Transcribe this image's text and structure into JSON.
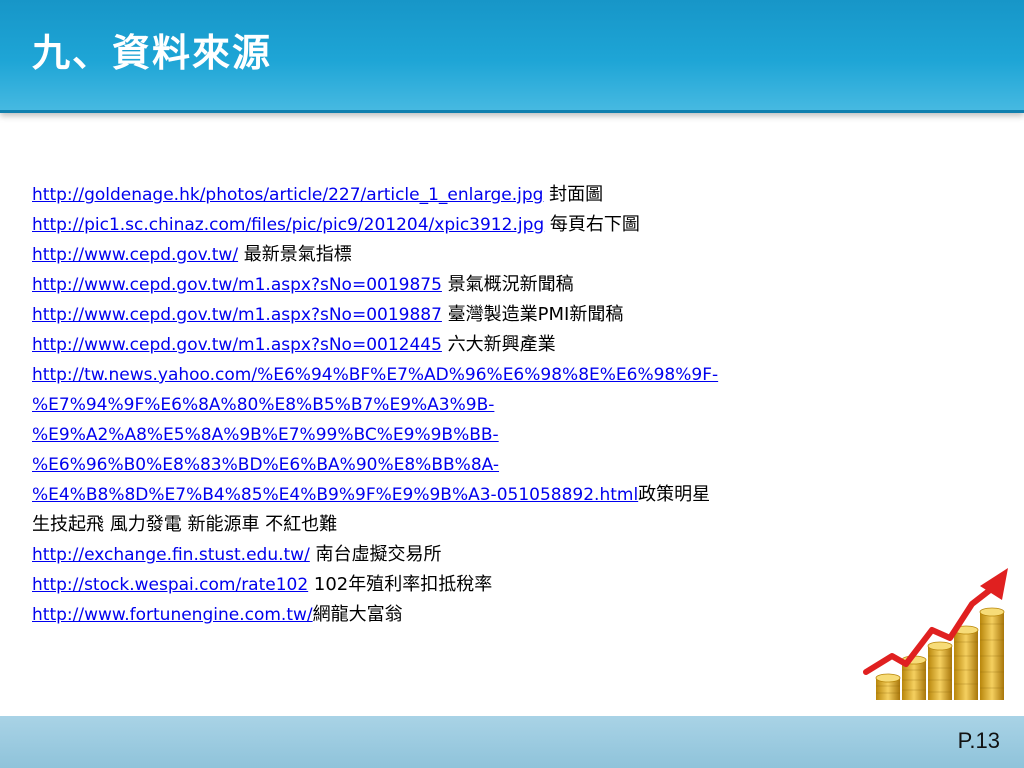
{
  "slide": {
    "title": "九、資料來源",
    "page_number": "P.13"
  },
  "sources": [
    {
      "url": "http://goldenage.hk/photos/article/227/article_1_enlarge.jpg",
      "desc": " 封面圖"
    },
    {
      "url": "http://pic1.sc.chinaz.com/files/pic/pic9/201204/xpic3912.jpg",
      "desc": " 每頁右下圖"
    },
    {
      "url": "http://www.cepd.gov.tw/",
      "desc": " 最新景氣指標"
    },
    {
      "url": "http://www.cepd.gov.tw/m1.aspx?sNo=0019875",
      "desc": " 景氣概況新聞稿"
    },
    {
      "url": "http://www.cepd.gov.tw/m1.aspx?sNo=0019887",
      "desc": " 臺灣製造業PMI新聞稿"
    },
    {
      "url": "http://www.cepd.gov.tw/m1.aspx?sNo=0012445",
      "desc": " 六大新興產業"
    }
  ],
  "long_source": {
    "url_lines": [
      "http://tw.news.yahoo.com/%E6%94%BF%E7%AD%96%E6%98%8E%E6%98%9F-",
      "%E7%94%9F%E6%8A%80%E8%B5%B7%E9%A3%9B-",
      "%E9%A2%A8%E5%8A%9B%E7%99%BC%E9%9B%BB-",
      "%E6%96%B0%E8%83%BD%E6%BA%90%E8%BB%8A-",
      "%E4%B8%8D%E7%B4%85%E4%B9%9F%E9%9B%A3-051058892.html"
    ],
    "desc_inline": "政策明星",
    "desc_continued": "生技起飛 風力發電 新能源車 不紅也難"
  },
  "more_sources": [
    {
      "url": "http://exchange.fin.stust.edu.tw/",
      "desc": " 南台虛擬交易所"
    },
    {
      "url": "http://stock.wespai.com/rate102",
      "desc": " 102年殖利率扣抵稅率"
    },
    {
      "url": "http://www.fortunengine.com.tw/",
      "desc": "網龍大富翁"
    }
  ],
  "colors": {
    "header": "#1ea5d6",
    "footer": "#9fcde3",
    "link": "#0000ee",
    "arrow": "#e02020",
    "coin": "#e8b830"
  },
  "icons": {
    "decoration": "gold-coins-rising-arrow-icon"
  }
}
